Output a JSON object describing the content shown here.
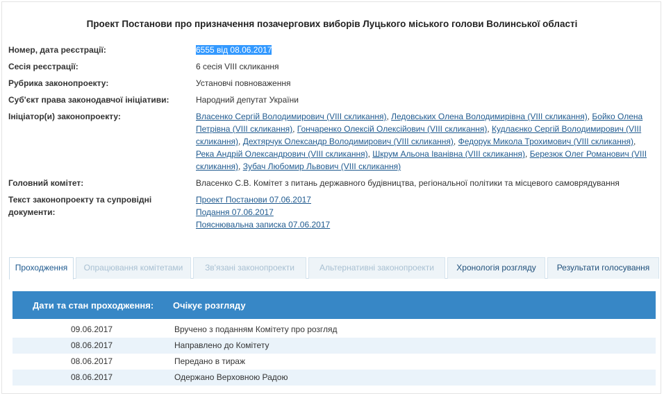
{
  "title": "Проект Постанови про призначення позачергових виборів Луцького міського голови Волинської області",
  "info": {
    "reg_label": "Номер, дата реєстрації:",
    "reg_value": "6555 від 08.06.2017",
    "session_label": "Сесія реєстрації:",
    "session_value": "6 сесія VIII скликання",
    "rubric_label": "Рубрика законопроекту:",
    "rubric_value": "Установчі повноваження",
    "subject_label": "Суб'єкт права законодавчої ініціативи:",
    "subject_value": "Народний депутат України",
    "initiators_label": "Ініціатор(и) законопроекту:",
    "initiators": [
      "Власенко Сергій Володимирович (VIII скликання)",
      "Ледовських Олена Володимирівна (VIII скликання)",
      "Бойко Олена Петрівна (VIII скликання)",
      "Гончаренко Олексій Олексійович (VIII скликання)",
      "Кудлаєнко Сергій Володимирович (VIII скликання)",
      "Дехтярчук Олександр Володимирович (VIII скликання)",
      "Федорук Микола Трохимович (VIII скликання)",
      "Река Андрій Олександрович (VIII скликання)",
      "Шкрум Альона Іванівна (VIII скликання)",
      "Березюк Олег Романович (VIII скликання)",
      "Зубач Любомир Львович (VIII скликання)"
    ],
    "committee_label": "Головний комітет:",
    "committee_value": "Власенко С.В. Комітет з питань державного будівництва, регіональної політики та місцевого самоврядування",
    "docs_label": "Текст законопроекту та супровідні документи:",
    "docs": [
      "Проект Постанови 07.06.2017",
      "Подання 07.06.2017",
      "Пояснювальна записка 07.06.2017"
    ]
  },
  "tabs": [
    "Проходження",
    "Опрацювання комітетами",
    "Зв'язані законопроекти",
    "Альтернативні законопроекти",
    "Хронологія розгляду",
    "Результати голосування"
  ],
  "table": {
    "header_left": "Дати та стан проходження:",
    "header_right": "Очікує розгляду",
    "rows": [
      {
        "date": "09.06.2017",
        "text": "Вручено з поданням Комітету про розгляд"
      },
      {
        "date": "08.06.2017",
        "text": "Направлено до Комітету"
      },
      {
        "date": "08.06.2017",
        "text": "Передано в тираж"
      },
      {
        "date": "08.06.2017",
        "text": "Одержано Верховною Радою"
      }
    ]
  },
  "colors": {
    "accent": "#3787c6",
    "link": "#1f5a8f",
    "row_alt": "#eaf3fa",
    "selection": "#3399ff"
  }
}
